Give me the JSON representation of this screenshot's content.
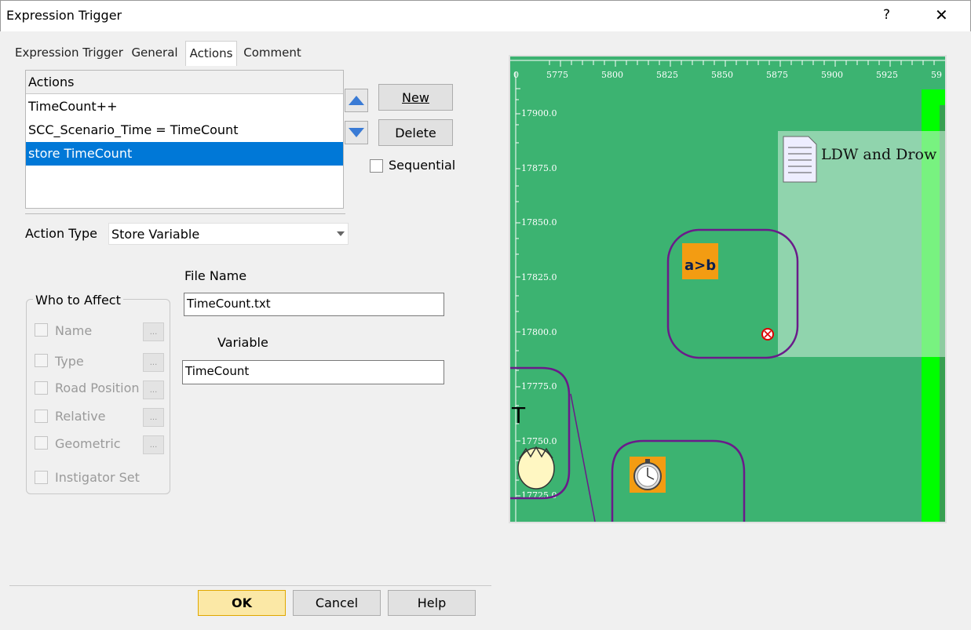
{
  "window": {
    "title": "Expression Trigger",
    "help": "?",
    "close": "✕"
  },
  "tabs": [
    {
      "label": "Expression Trigger"
    },
    {
      "label": "General"
    },
    {
      "label": "Actions"
    },
    {
      "label": "Comment"
    }
  ],
  "actions": {
    "header": "Actions",
    "items": [
      "TimeCount++",
      "SCC_Scenario_Time = TimeCount",
      "store TimeCount"
    ],
    "selected_index": 2
  },
  "buttons": {
    "new": "New",
    "delete": "Delete",
    "ok": "OK",
    "cancel": "Cancel",
    "help": "Help"
  },
  "sequential": {
    "label": "Sequential",
    "checked": false
  },
  "action_type": {
    "label": "Action Type",
    "value": "Store Variable"
  },
  "who_to_affect": {
    "title": "Who to Affect",
    "items": [
      "Name",
      "Type",
      "Road Position",
      "Relative",
      "Geometric"
    ],
    "instigator": "Instigator Set"
  },
  "file_name": {
    "label": "File Name",
    "value": "TimeCount.txt"
  },
  "variable": {
    "label": "Variable",
    "value": "TimeCount"
  },
  "map": {
    "x_ticks": [
      "0",
      "5775",
      "5800",
      "5825",
      "5850",
      "5875",
      "5900",
      "5925",
      "59"
    ],
    "y_ticks": [
      "17900.0",
      "17875.0",
      "17850.0",
      "17825.0",
      "17800.0",
      "17775.0",
      "17750.0",
      "17725.0"
    ],
    "note_text": "LDW and Drow",
    "expr_icon_text": "a>b",
    "background_color": "#3cb371",
    "lane_color": "#00ff00"
  }
}
